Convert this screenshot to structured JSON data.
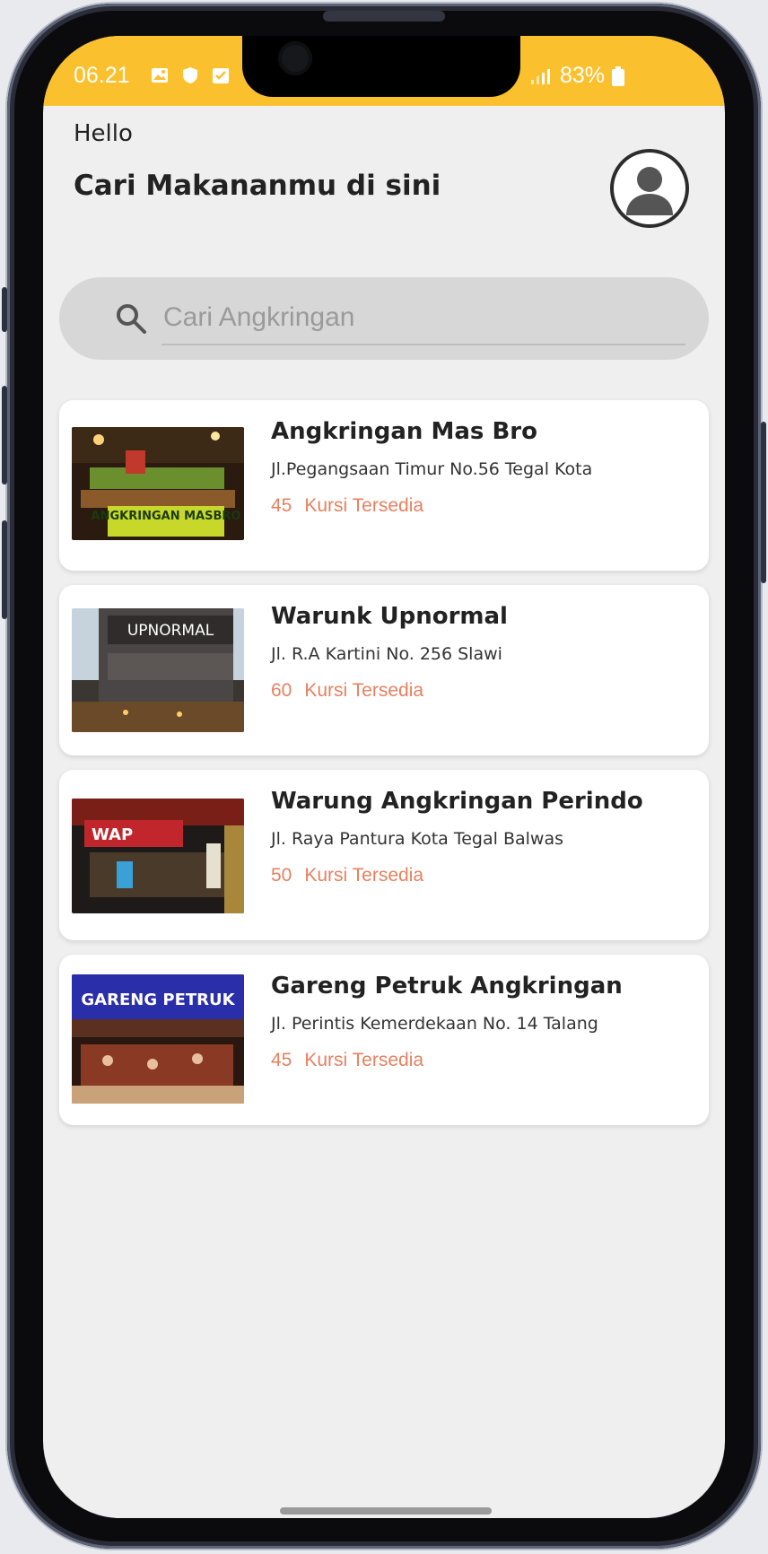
{
  "status_bar": {
    "time": "06.21",
    "battery": "83%",
    "accent_color": "#fbc02d"
  },
  "header": {
    "greeting": "Hello",
    "subtitle": "Cari Makananmu di sini"
  },
  "search": {
    "placeholder": "Cari Angkringan",
    "value": ""
  },
  "restaurants": [
    {
      "name": "Angkringan Mas Bro",
      "address": "Jl.Pegangsaan Timur No.56 Tegal Kota",
      "seats": "45",
      "seats_label": "Kursi Tersedia",
      "image_text": "ANGKRINGAN MASBRO"
    },
    {
      "name": "Warunk Upnormal",
      "address": "Jl. R.A Kartini No. 256 Slawi",
      "seats": "60",
      "seats_label": "Kursi Tersedia",
      "image_text": "UPNORMAL"
    },
    {
      "name": "Warung Angkringan Perindo",
      "address": "Jl. Raya Pantura Kota Tegal Balwas",
      "seats": "50",
      "seats_label": "Kursi Tersedia",
      "image_text": "WAP"
    },
    {
      "name": "Gareng Petruk Angkringan",
      "address": "Jl. Perintis Kemerdekaan No. 14 Talang",
      "seats": "45",
      "seats_label": "Kursi Tersedia",
      "image_text": "GARENG PETRUK"
    }
  ],
  "icons": {
    "search": "search-icon",
    "avatar": "user-avatar-icon"
  },
  "colors": {
    "seats_text": "#e7805f",
    "background": "#efefef"
  }
}
